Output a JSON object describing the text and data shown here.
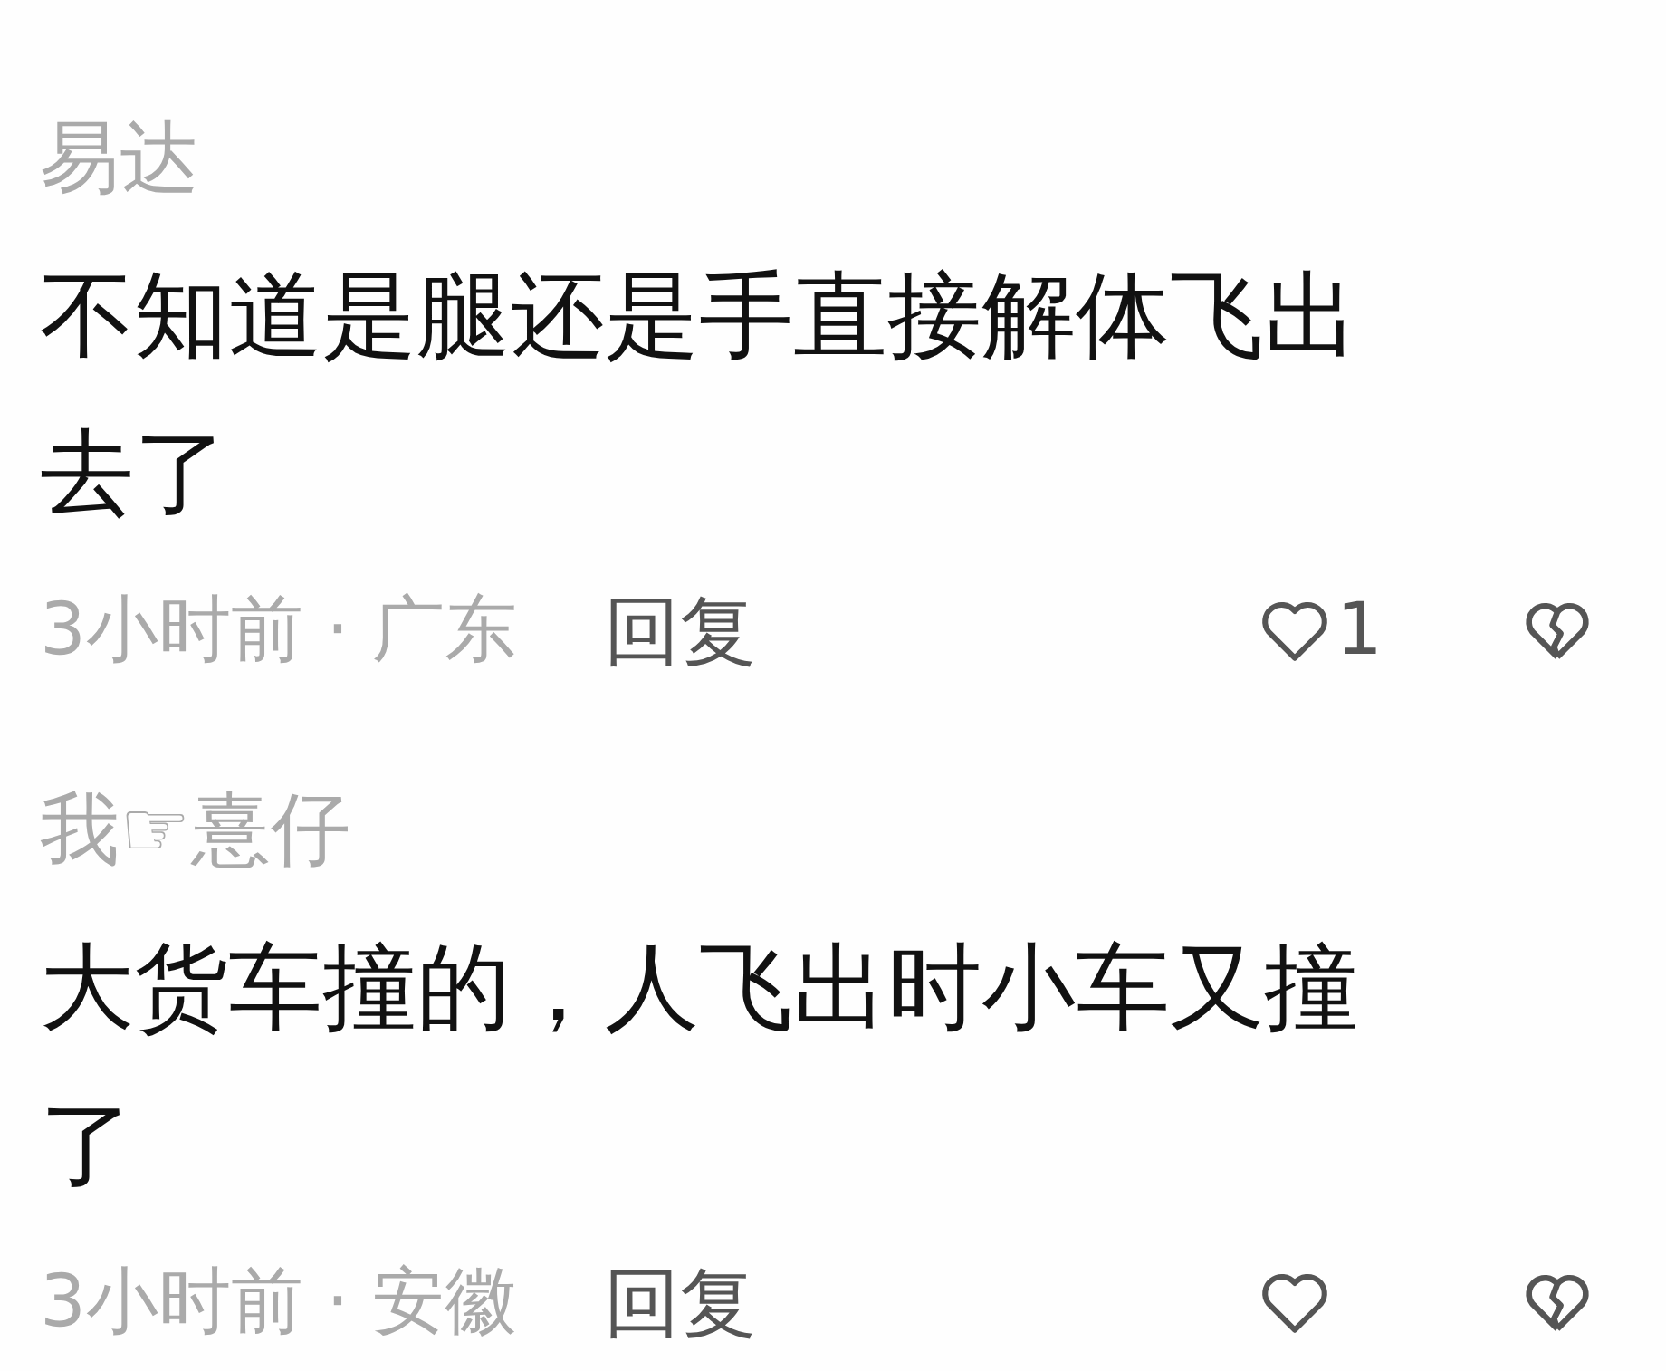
{
  "comments": [
    {
      "username": "易达",
      "text": "不知道是腿还是手直接解体飞出去了",
      "time": "3小时前",
      "separator": "·",
      "location": "广东",
      "reply": "回复",
      "likes": "1"
    },
    {
      "username": "我☞憙仔",
      "text": "大货车撞的，人飞出时小车又撞了",
      "time": "3小时前",
      "separator": "·",
      "location": "安徽",
      "reply": "回复"
    }
  ]
}
